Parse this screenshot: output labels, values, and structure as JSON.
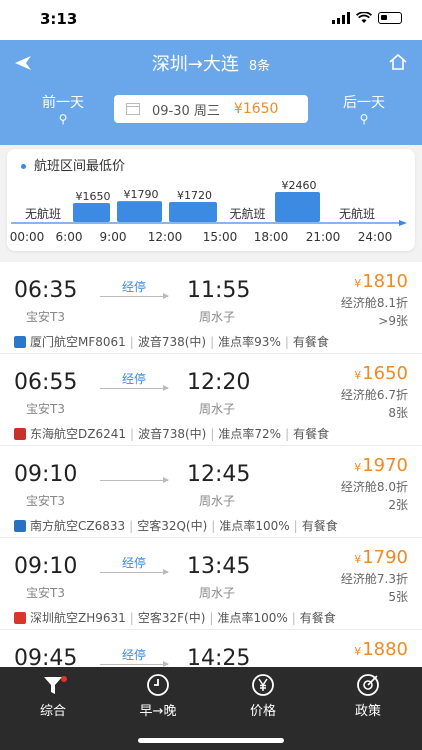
{
  "status": {
    "time": "3:13"
  },
  "header": {
    "route": "深圳→大连",
    "count": "8条",
    "prev_day": "前一天",
    "next_day": "后一天",
    "date": "09-30 周三",
    "date_price": "¥1650"
  },
  "chart": {
    "title": "航班区间最低价",
    "no_flight": "无航班",
    "time_labels": [
      "00:00",
      "6:00",
      "9:00",
      "12:00",
      "15:00",
      "18:00",
      "21:00",
      "24:00"
    ]
  },
  "chart_data": {
    "type": "bar",
    "title": "航班区间最低价",
    "categories": [
      "00:00-6:00",
      "6:00-9:00",
      "9:00-12:00",
      "12:00-15:00",
      "15:00-18:00",
      "18:00-21:00",
      "21:00-24:00"
    ],
    "values": [
      null,
      1650,
      1790,
      1720,
      null,
      2460,
      null
    ],
    "value_labels": [
      "无航班",
      "¥1650",
      "¥1790",
      "¥1720",
      "无航班",
      "¥2460",
      "无航班"
    ],
    "x_ticks": [
      "00:00",
      "6:00",
      "9:00",
      "12:00",
      "15:00",
      "18:00",
      "21:00",
      "24:00"
    ],
    "bar_color": "#3d8ae2"
  },
  "flights": [
    {
      "dep": "06:35",
      "dep_ap": "宝安T3",
      "stop": "经停",
      "arr": "11:55",
      "arr_ap": "周水子",
      "yen": "¥",
      "price": "1810",
      "cabin": "经济舱8.1折",
      "seats": ">9张",
      "airline": "厦门航空MF8061",
      "plane": "波音738(中)",
      "ontime": "准点率93%",
      "meal": "有餐食",
      "logo": "xiamen-logo-icon"
    },
    {
      "dep": "06:55",
      "dep_ap": "宝安T3",
      "stop": "经停",
      "arr": "12:20",
      "arr_ap": "周水子",
      "yen": "¥",
      "price": "1650",
      "cabin": "经济舱6.7折",
      "seats": "8张",
      "airline": "东海航空DZ6241",
      "plane": "波音738(中)",
      "ontime": "准点率72%",
      "meal": "有餐食",
      "logo": "donghai-logo-icon"
    },
    {
      "dep": "09:10",
      "dep_ap": "宝安T3",
      "stop": "",
      "arr": "12:45",
      "arr_ap": "周水子",
      "yen": "¥",
      "price": "1970",
      "cabin": "经济舱8.0折",
      "seats": "2张",
      "airline": "南方航空CZ6833",
      "plane": "空客32Q(中)",
      "ontime": "准点率100%",
      "meal": "有餐食",
      "logo": "southern-logo-icon"
    },
    {
      "dep": "09:10",
      "dep_ap": "宝安T3",
      "stop": "经停",
      "arr": "13:45",
      "arr_ap": "周水子",
      "yen": "¥",
      "price": "1790",
      "cabin": "经济舱7.3折",
      "seats": "5张",
      "airline": "深圳航空ZH9631",
      "plane": "空客32F(中)",
      "ontime": "准点率100%",
      "meal": "有餐食",
      "logo": "shenzhen-logo-icon"
    },
    {
      "dep": "09:45",
      "dep_ap": "",
      "stop": "经停",
      "arr": "14:25",
      "arr_ap": "",
      "yen": "¥",
      "price": "1880",
      "cabin": "",
      "seats": "",
      "airline": "",
      "plane": "",
      "ontime": "",
      "meal": "",
      "logo": ""
    }
  ],
  "tabs": [
    {
      "label": "综合",
      "icon": "filter-icon"
    },
    {
      "label": "早→晚",
      "icon": "clock-icon"
    },
    {
      "label": "价格",
      "icon": "yen-icon"
    },
    {
      "label": "政策",
      "icon": "policy-icon"
    }
  ],
  "colors": {
    "header": "#6aa7ea",
    "accent": "#f08a24",
    "bar": "#3d8ae2",
    "tabbar": "#2b2b2b"
  }
}
